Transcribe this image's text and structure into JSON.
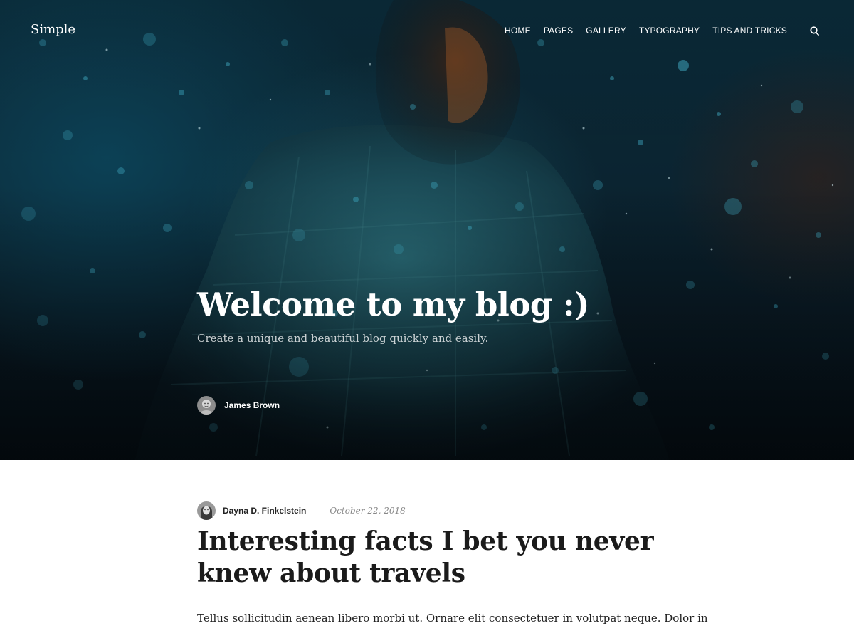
{
  "site": {
    "title": "Simple"
  },
  "nav": {
    "items": [
      {
        "label": "HOME"
      },
      {
        "label": "PAGES"
      },
      {
        "label": "GALLERY"
      },
      {
        "label": "TYPOGRAPHY"
      },
      {
        "label": "TIPS AND TRICKS"
      }
    ],
    "search_icon": "search-icon"
  },
  "hero": {
    "title": "Welcome to my blog :)",
    "subtitle": "Create a unique and beautiful blog quickly and easily.",
    "author": {
      "name": "James Brown",
      "avatar_icon": "avatar"
    }
  },
  "post": {
    "author": "Dayna D. Finkelstein",
    "date": "October 22, 2018",
    "title": "Interesting facts I bet you never knew about travels",
    "excerpt": "Tellus sollicitudin aenean libero morbi ut. Ornare elit consectetuer in volutpat neque. Dolor in"
  },
  "colors": {
    "hero_background": "#0b2431",
    "hero_accent": "#1e5f6e",
    "text_dark": "#1b1b1b",
    "meta_gray": "#888888"
  }
}
